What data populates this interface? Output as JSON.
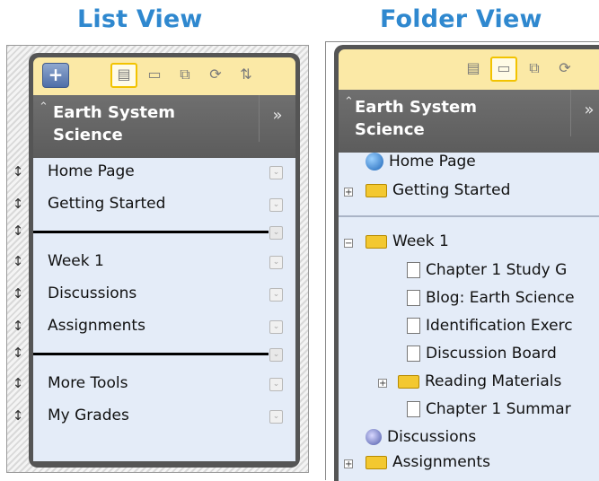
{
  "list_view": {
    "title": "List View",
    "toolbar": {
      "add_label": "+",
      "icons": [
        "list-icon",
        "folder-icon",
        "window-icon",
        "refresh-icon",
        "sort-icon"
      ]
    },
    "course": {
      "name": "Earth System Science",
      "collapse_label": "»"
    },
    "items": [
      {
        "label": "Home Page"
      },
      {
        "label": "Getting Started"
      },
      {
        "label": "Week 1"
      },
      {
        "label": "Discussions"
      },
      {
        "label": "Assignments"
      },
      {
        "label": "More Tools"
      },
      {
        "label": "My Grades"
      }
    ]
  },
  "folder_view": {
    "title": "Folder View",
    "course": {
      "name": "Earth System Science",
      "collapse_label": "»"
    },
    "tree": [
      {
        "label": "Home Page"
      },
      {
        "label": "Getting Started"
      },
      {
        "label": "Week 1"
      },
      {
        "label": "Chapter 1 Study G"
      },
      {
        "label": "Blog: Earth Science"
      },
      {
        "label": "Identification Exerc"
      },
      {
        "label": "Discussion Board"
      },
      {
        "label": "Reading Materials"
      },
      {
        "label": "Chapter 1 Summar"
      },
      {
        "label": "Discussions"
      },
      {
        "label": "Assignments"
      }
    ]
  },
  "colors": {
    "title_blue": "#2f88cf",
    "toolbar_yellow": "#fbe9a6",
    "list_bg": "#e4ecf8",
    "header_gray": "#5f5f5f"
  }
}
